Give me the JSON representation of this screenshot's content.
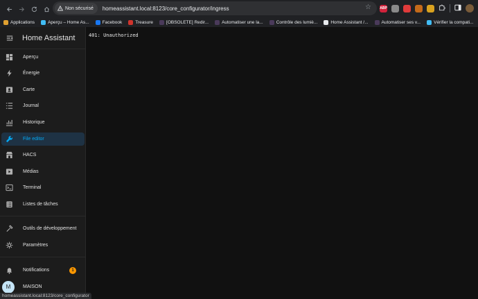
{
  "browser": {
    "security_label": "Non sécurisé",
    "url": "homeassistant.local:8123/core_configurator/ingress",
    "extensions": [
      {
        "name": "abp-extension-icon",
        "text": "ABP",
        "color": "#d1223b"
      },
      {
        "name": "image-extension-icon",
        "text": "",
        "color": "#8a8a8a"
      },
      {
        "name": "shield-extension-icon",
        "text": "",
        "color": "#e03b3b"
      },
      {
        "name": "chart-extension-icon",
        "text": "",
        "color": "#c46a1a"
      },
      {
        "name": "sun-extension-icon",
        "text": "",
        "color": "#d9a21f"
      }
    ]
  },
  "bookmarks": [
    {
      "label": "Applications",
      "color": "#e0a030"
    },
    {
      "label": "Aperçu – Home As...",
      "color": "#41bdf5"
    },
    {
      "label": "Facebook",
      "color": "#1877f2"
    },
    {
      "label": "Treasure",
      "color": "#d0342c"
    },
    {
      "label": "[OBSOLETE] Redir...",
      "color": "#4a3a5a"
    },
    {
      "label": "Automatiser une la...",
      "color": "#4a3a5a"
    },
    {
      "label": "Contrôle des lumiè...",
      "color": "#4a3a5a"
    },
    {
      "label": "Home Assistant /...",
      "color": "#e8eaed"
    },
    {
      "label": "Automatiser ses v...",
      "color": "#4a3a5a"
    },
    {
      "label": "Vérifier la compati...",
      "color": "#41bdf5"
    }
  ],
  "sidebar": {
    "title": "Home Assistant",
    "items": [
      {
        "label": "Aperçu",
        "icon": "dashboard-icon"
      },
      {
        "label": "Énergie",
        "icon": "lightning-icon"
      },
      {
        "label": "Carte",
        "icon": "map-icon"
      },
      {
        "label": "Journal",
        "icon": "logbook-icon"
      },
      {
        "label": "Historique",
        "icon": "history-icon"
      },
      {
        "label": "File editor",
        "icon": "wrench-icon",
        "active": true
      },
      {
        "label": "HACS",
        "icon": "hacs-icon"
      },
      {
        "label": "Médias",
        "icon": "media-icon"
      },
      {
        "label": "Terminal",
        "icon": "terminal-icon"
      },
      {
        "label": "Listes de tâches",
        "icon": "todo-list-icon"
      }
    ],
    "dev_tools": "Outils de développement",
    "settings": "Paramètres",
    "notifications": "Notifications",
    "notifications_count": "1",
    "user_initial": "M",
    "user_name": "MAISON"
  },
  "main": {
    "error": "401: Unauthorized"
  },
  "status_bar": "homeassistant.local:8123/core_configurator",
  "colors": {
    "accent": "#03a9f4",
    "active_bg": "#1e3244",
    "badge": "#ff9800"
  }
}
